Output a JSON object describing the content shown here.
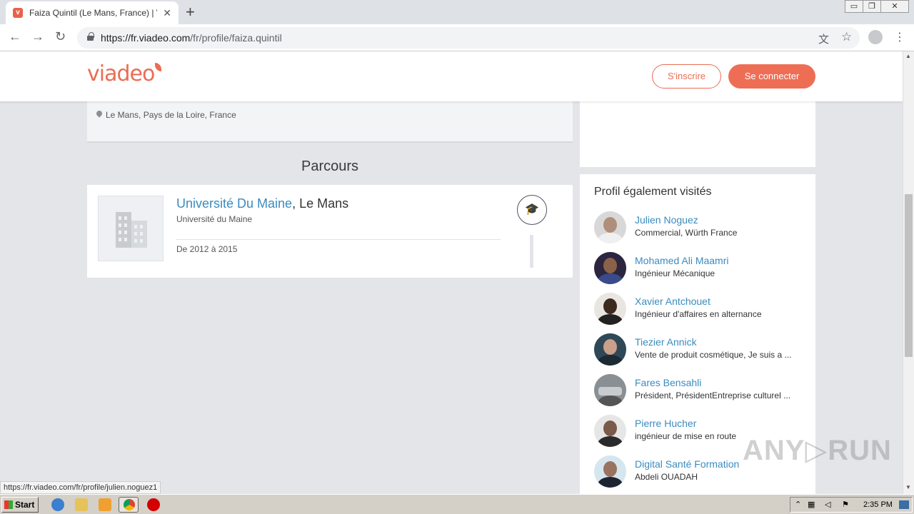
{
  "browser": {
    "tab_title": "Faiza Quintil (Le Mans, France) | Viadeo",
    "tab_close": "✕",
    "new_tab": "+",
    "url_host": "https://fr.viadeo.com",
    "url_path": "/fr/profile/faiza.quintil",
    "back_icon": "←",
    "forward_icon": "→",
    "reload_icon": "↻",
    "translate_icon": "文",
    "star_icon": "☆",
    "menu_icon": "⋮",
    "win_minimize": "▭",
    "win_restore": "❐",
    "win_close": "✕"
  },
  "header": {
    "logo": "viadeo",
    "signup_label": "S'inscrire",
    "login_label": "Se connecter",
    "accent_color": "#ee6e55"
  },
  "profile": {
    "location": "Le Mans, Pays de la Loire, France"
  },
  "parcours": {
    "title": "Parcours",
    "items": [
      {
        "school_link": "Université Du Maine",
        "school_city": ", Le Mans",
        "subtitle": "Université du Maine",
        "dates": "De 2012 à 2015",
        "badge_icon": "graduation-cap-icon"
      }
    ]
  },
  "visited": {
    "title": "Profil également visités",
    "people": [
      {
        "name": "Julien Noguez",
        "role": "Commercial, Würth France"
      },
      {
        "name": "Mohamed Ali Maamri",
        "role": "Ingénieur Mécanique"
      },
      {
        "name": "Xavier Antchouet",
        "role": "Ingénieur d'affaires en alternance"
      },
      {
        "name": "Tiezier Annick",
        "role": "Vente de produit cosmétique, Je suis a ..."
      },
      {
        "name": "Fares Bensahli",
        "role": "Président, PrésidentEntreprise culturel ..."
      },
      {
        "name": "Pierre Hucher",
        "role": "ingénieur de mise en route"
      },
      {
        "name": "Digital Santé Formation",
        "role": "Abdeli OUADAH"
      }
    ]
  },
  "status_bar": {
    "hover_url": "https://fr.viadeo.com/fr/profile/julien.noguez1"
  },
  "watermark": "ANY▷RUN",
  "taskbar": {
    "start_label": "Start",
    "clock": "2:35 PM"
  }
}
